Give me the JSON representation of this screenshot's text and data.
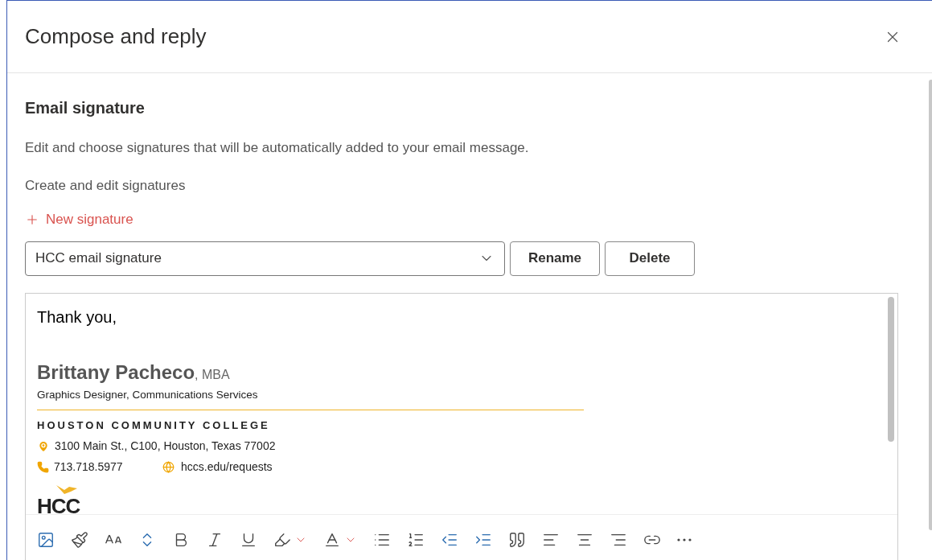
{
  "dialog": {
    "title": "Compose and reply"
  },
  "section": {
    "heading": "Email signature",
    "description": "Edit and choose signatures that will be automatically added to your email message.",
    "subheading": "Create and edit signatures",
    "new_link": "New signature"
  },
  "signature_select": {
    "value": "HCC email signature"
  },
  "buttons": [
    "Rename",
    "Delete"
  ],
  "editor": {
    "greeting": "Thank you,",
    "name": "Brittany Pacheco",
    "credential": ", MBA",
    "title": "Graphics Designer, Communications Services",
    "org": "HOUSTON COMMUNITY COLLEGE",
    "address": "3100 Main St., C100, Houston, Texas 77002",
    "phone": "713.718.5977",
    "website": "hccs.edu/requests",
    "logo": "HCC"
  },
  "toolbar": [
    {
      "kind": "image"
    },
    {
      "kind": "painter"
    },
    {
      "kind": "font"
    },
    {
      "kind": "size"
    },
    {
      "kind": "bold"
    },
    {
      "kind": "italic"
    },
    {
      "kind": "underline"
    },
    {
      "kind": "highlight"
    },
    {
      "kind": "color"
    },
    {
      "kind": "bullets"
    },
    {
      "kind": "numbers"
    },
    {
      "kind": "outdent"
    },
    {
      "kind": "indent"
    },
    {
      "kind": "quote"
    },
    {
      "kind": "left"
    },
    {
      "kind": "center"
    },
    {
      "kind": "right"
    },
    {
      "kind": "link"
    },
    {
      "kind": "more"
    }
  ]
}
